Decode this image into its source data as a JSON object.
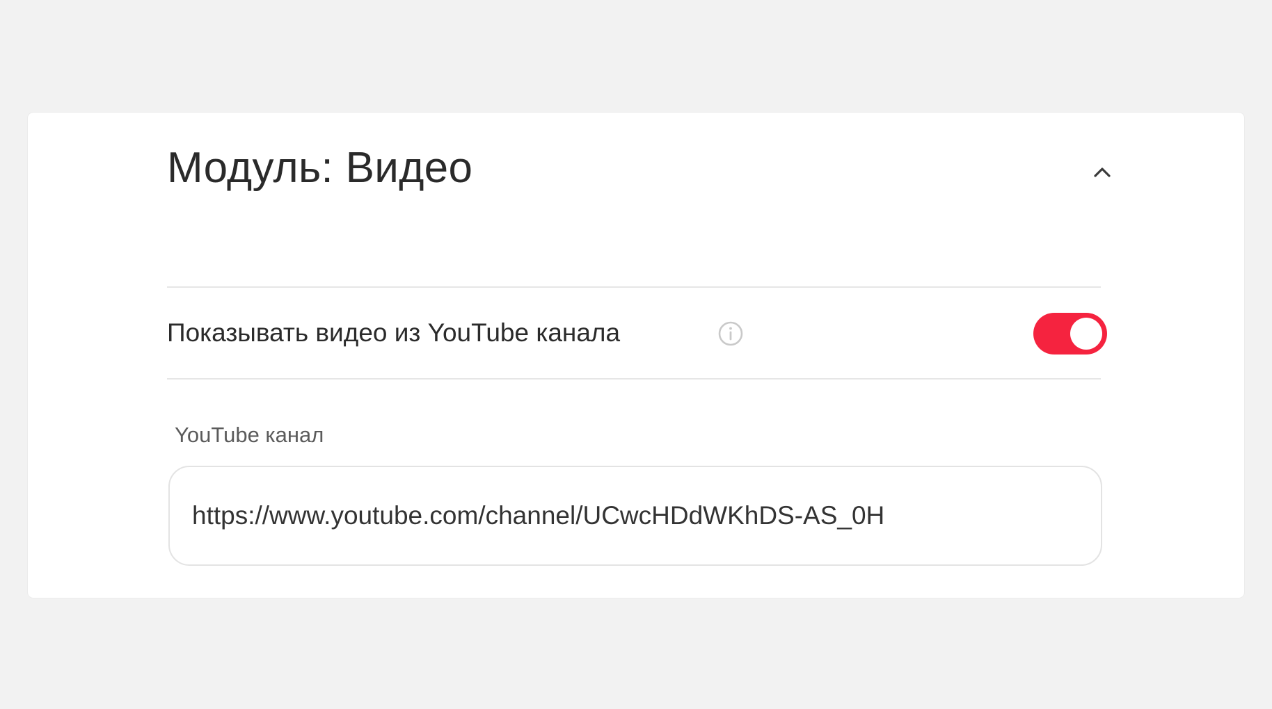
{
  "module": {
    "title": "Модуль: Видео"
  },
  "setting": {
    "label": "Показывать видео из YouTube канала",
    "enabled": true
  },
  "channel_field": {
    "label": "YouTube канал",
    "value": "https://www.youtube.com/channel/UCwcHDdWKhDS-AS_0H"
  },
  "colors": {
    "background": "#f2f2f2",
    "card": "#ffffff",
    "toggle_on": "#f5233f",
    "title_text": "#2a2a2a",
    "secondary_text": "#5b5b5b",
    "divider": "#e6e6e6"
  },
  "icons": {
    "collapse": "chevron-up-icon",
    "info": "info-icon"
  }
}
